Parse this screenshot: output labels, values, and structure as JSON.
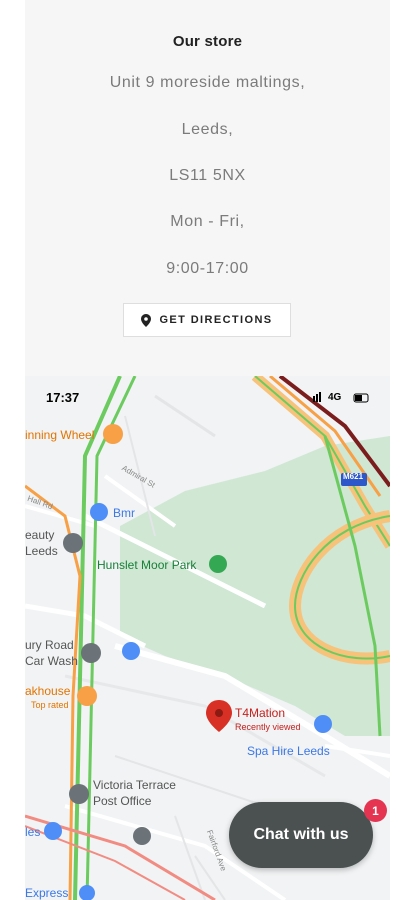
{
  "store": {
    "title": "Our store",
    "address_line1": "Unit 9 moreside maltings,",
    "address_line2": "Leeds,",
    "postcode": "LS11 5NX",
    "days": "Mon - Fri,",
    "hours": "9:00-17:00",
    "directions_label": "GET DIRECTIONS",
    "directions_icon": "map-pin-icon"
  },
  "map": {
    "status_time": "17:37",
    "network": "4G",
    "motorway_shield": "M621",
    "places": {
      "spinning_wheel": "inning Wheel",
      "bmr": "Bmr",
      "beauty_line1": "eauty",
      "beauty_line2": "Leeds",
      "park": "Hunslet Moor Park",
      "carwash_line1": "ury Road",
      "carwash_line2": "Car Wash",
      "steakhouse": "akhouse",
      "steakhouse_sub": "Top rated",
      "t4mation": "T4Mation",
      "t4mation_sub": "Recently viewed",
      "spa_hire": "Spa Hire Leeds",
      "post_office_line1": "Victoria Terrace",
      "post_office_line2": "Post Office",
      "les": "les",
      "express": "Express",
      "admiral_st": "Admiral St",
      "fairford_ave": "Fairford Ave",
      "hall_rd": "Hall Rd"
    },
    "colors": {
      "park": "#cfe7d3",
      "traffic_green": "#6ccb5f",
      "traffic_orange": "#f7a046",
      "traffic_red": "#d93025",
      "pin_red": "#d93025",
      "blue_poi": "#4f8ef7"
    }
  },
  "chat": {
    "label": "Chat with us",
    "badge_count": "1"
  }
}
